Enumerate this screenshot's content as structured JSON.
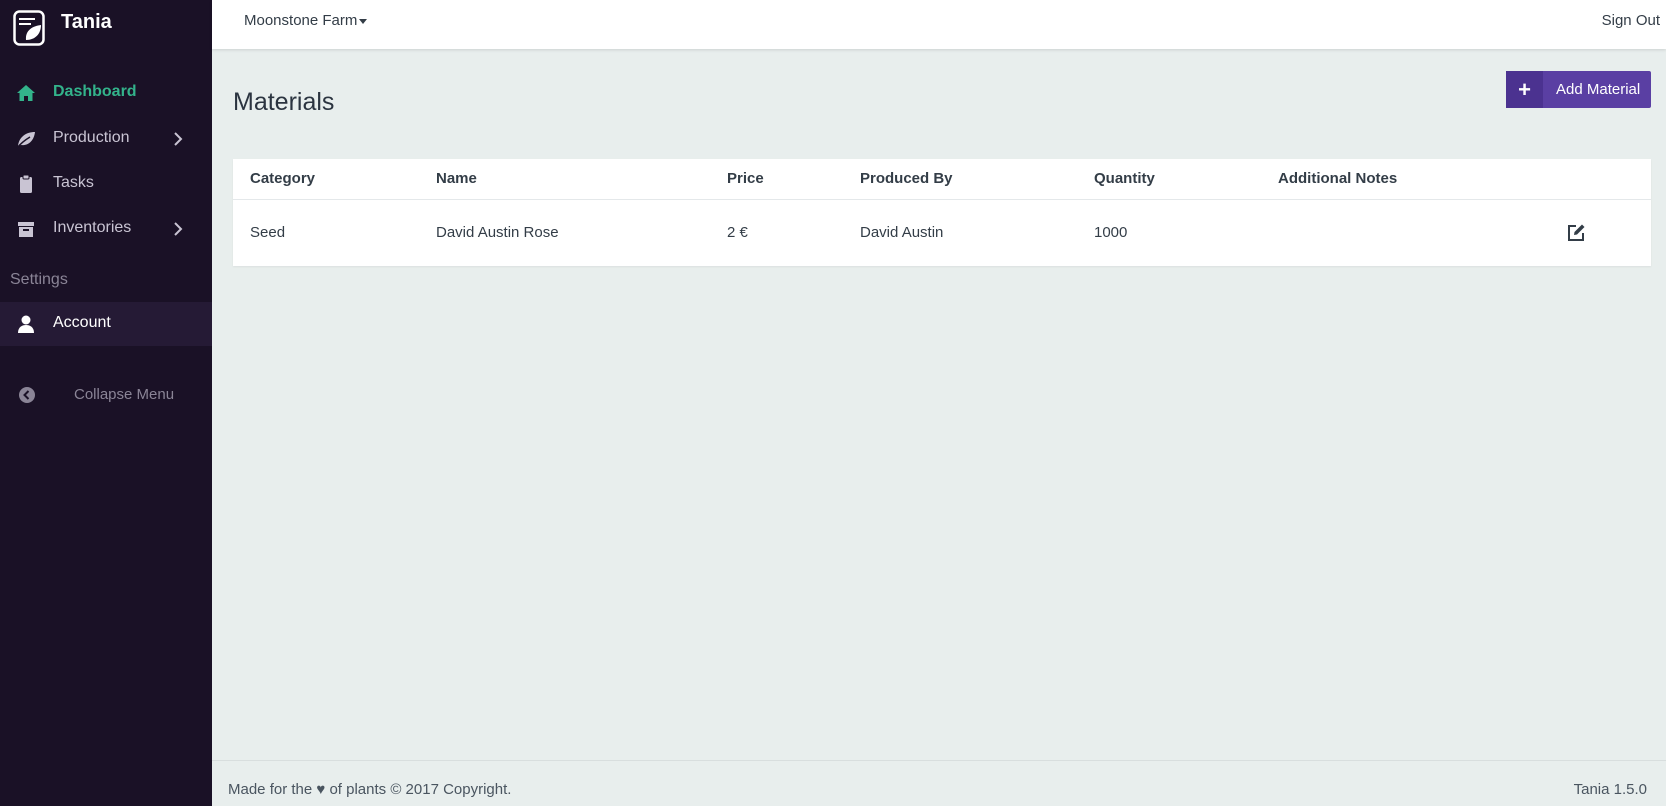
{
  "app": {
    "name": "Tania"
  },
  "sidebar": {
    "items": [
      {
        "label": "Dashboard",
        "icon": "home-icon",
        "active": true
      },
      {
        "label": "Production",
        "icon": "leaf-icon",
        "has_submenu": true
      },
      {
        "label": "Tasks",
        "icon": "clipboard-icon"
      },
      {
        "label": "Inventories",
        "icon": "archive-icon",
        "has_submenu": true
      }
    ],
    "section_label": "Settings",
    "settings_items": [
      {
        "label": "Account",
        "icon": "user-icon",
        "selected": true
      }
    ],
    "collapse_label": "Collapse Menu"
  },
  "topbar": {
    "farm_name": "Moonstone Farm",
    "signout_label": "Sign Out"
  },
  "page": {
    "title": "Materials",
    "add_button_label": "Add Material"
  },
  "table": {
    "columns": [
      "Category",
      "Name",
      "Price",
      "Produced By",
      "Quantity",
      "Additional Notes"
    ],
    "rows": [
      {
        "category": "Seed",
        "name": "David Austin Rose",
        "price": "2 €",
        "produced_by": "David Austin",
        "quantity": "1000",
        "notes": ""
      }
    ]
  },
  "footer": {
    "left": "Made for the ♥ of plants © 2017 Copyright.",
    "right": "Tania 1.5.0"
  },
  "colors": {
    "sidebar_bg": "#1a1126",
    "active_green": "#33b38b",
    "accent_purple": "#5a3fa3",
    "content_bg": "#e8eeed"
  }
}
